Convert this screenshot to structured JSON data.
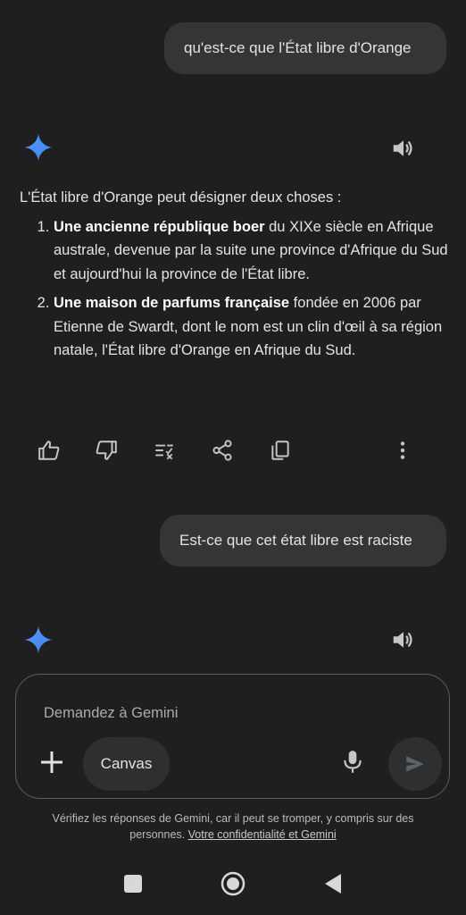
{
  "conversation": {
    "user_message_1": "qu'est-ce que l'État libre d'Orange",
    "response_1": {
      "intro": "L'État libre d'Orange peut désigner deux choses :",
      "items": [
        {
          "number": "1.",
          "bold": "Une ancienne république boer",
          "text": " du XIXe siècle en Afrique australe, devenue par la suite une province d'Afrique du Sud et aujourd'hui la province de l'État libre."
        },
        {
          "number": "2.",
          "bold": "Une maison de parfums française",
          "text": " fondée en 2006 par Etienne de Swardt, dont le nom est un clin d'œil à sa région natale, l'État libre d'Orange en Afrique du Sud."
        }
      ]
    },
    "user_message_2": "Est-ce que cet état libre est raciste"
  },
  "icons": {
    "gemini": "gemini-sparkle-icon",
    "speaker": "speaker-icon",
    "thumbs_up": "thumbs-up-icon",
    "thumbs_down": "thumbs-down-icon",
    "modify": "modify-response-icon",
    "share": "share-icon",
    "copy": "copy-icon",
    "more": "more-vert-icon",
    "plus": "plus-icon",
    "mic": "microphone-icon",
    "send": "send-icon"
  },
  "composer": {
    "placeholder": "Demandez à Gemini",
    "canvas_label": "Canvas"
  },
  "footer": {
    "disclaimer": "Vérifiez les réponses de Gemini, car il peut se tromper, y compris sur des personnes.",
    "link": "Votre confidentialité et Gemini"
  },
  "colors": {
    "background": "#1f1f1f",
    "bubble": "#333537",
    "text": "#e3e3e3",
    "gemini_blue": "#4a8df8"
  }
}
